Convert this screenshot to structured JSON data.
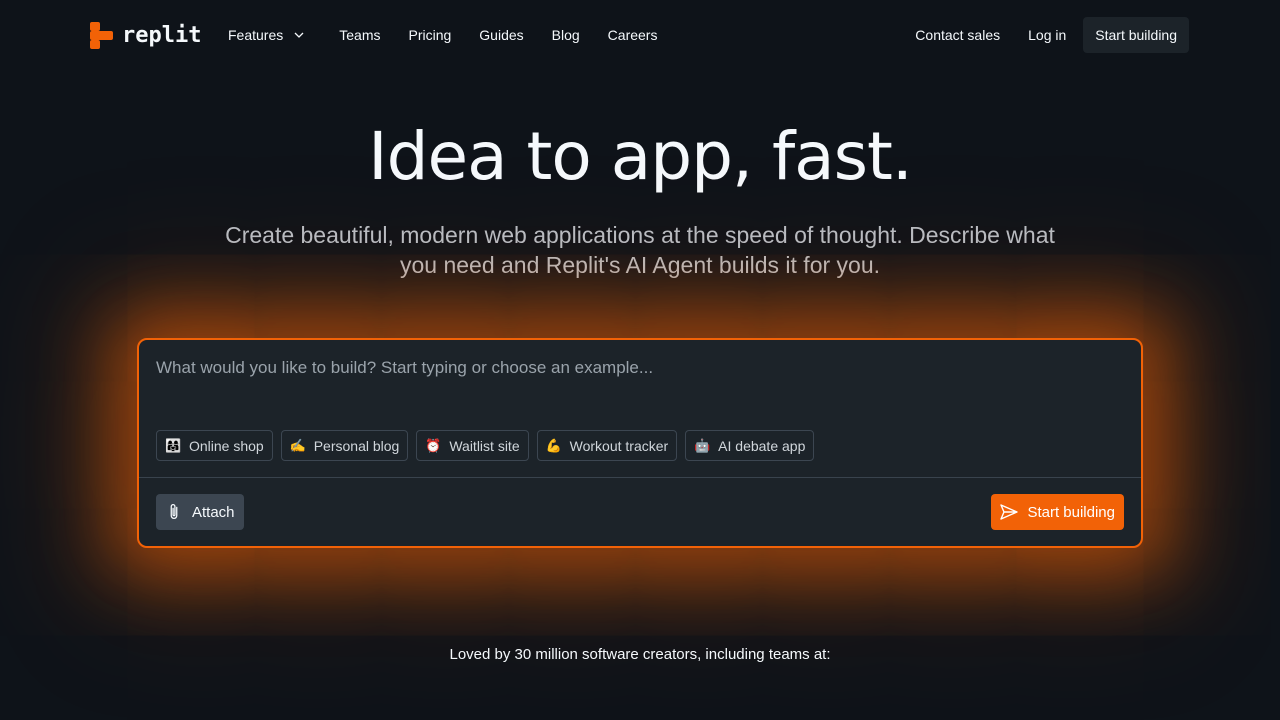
{
  "nav": {
    "logo_text": "replit",
    "links": [
      {
        "label": "Features"
      },
      {
        "label": "Teams"
      },
      {
        "label": "Pricing"
      },
      {
        "label": "Guides"
      },
      {
        "label": "Blog"
      },
      {
        "label": "Careers"
      }
    ],
    "contact_label": "Contact sales",
    "login_label": "Log in",
    "start_label": "Start building"
  },
  "hero": {
    "title": "Idea to app, fast.",
    "subtitle": "Create beautiful, modern web applications at the speed of thought. Describe what you need and Replit's AI Agent builds it for you."
  },
  "prompt": {
    "placeholder": "What would you like to build? Start typing or choose an example...",
    "examples": [
      {
        "emoji": "👩‍👩‍👧",
        "label": "Online shop"
      },
      {
        "emoji": "✍️",
        "label": "Personal blog"
      },
      {
        "emoji": "⏰",
        "label": "Waitlist site"
      },
      {
        "emoji": "💪",
        "label": "Workout tracker"
      },
      {
        "emoji": "🤖",
        "label": "AI debate app"
      }
    ],
    "attach_label": "Attach",
    "submit_label": "Start building"
  },
  "footer": {
    "loved_text": "Loved by 30 million software creators, including teams at:"
  },
  "colors": {
    "accent": "#f26207",
    "background": "#0e1319",
    "surface": "#1c2329"
  }
}
